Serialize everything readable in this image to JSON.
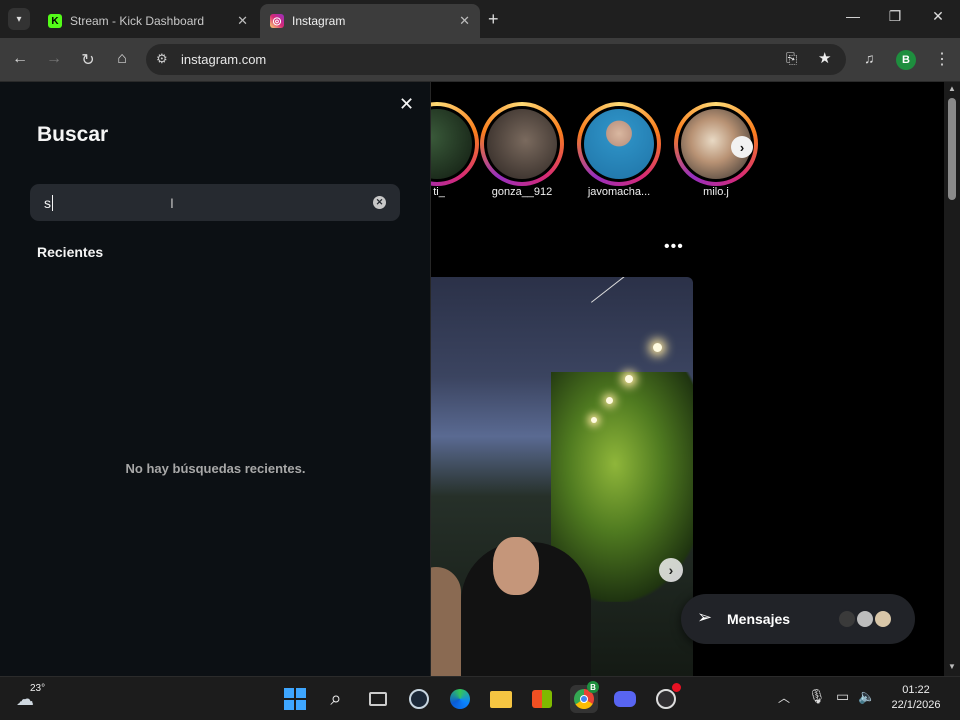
{
  "browser": {
    "tabs": [
      {
        "label": "Stream - Kick Dashboard",
        "favicon": "kick-icon",
        "color": "#53fc18"
      },
      {
        "label": "Instagram",
        "favicon": "instagram-icon",
        "color": "#e1306c"
      }
    ],
    "new_tab_glyph": "+",
    "url": "instagram.com",
    "profile_initial": "B"
  },
  "search_panel": {
    "title": "Buscar",
    "query": "s",
    "recent_heading": "Recientes",
    "empty_message": "No hay búsquedas recientes."
  },
  "stories": [
    {
      "name": "ti_"
    },
    {
      "name": "gonza__912"
    },
    {
      "name": "javomacha..."
    },
    {
      "name": "milo.j"
    }
  ],
  "messages": {
    "label": "Mensajes"
  },
  "taskbar": {
    "temperature": "23°",
    "time": "01:22",
    "date": "22/1/2026",
    "chrome_badge": "B"
  }
}
